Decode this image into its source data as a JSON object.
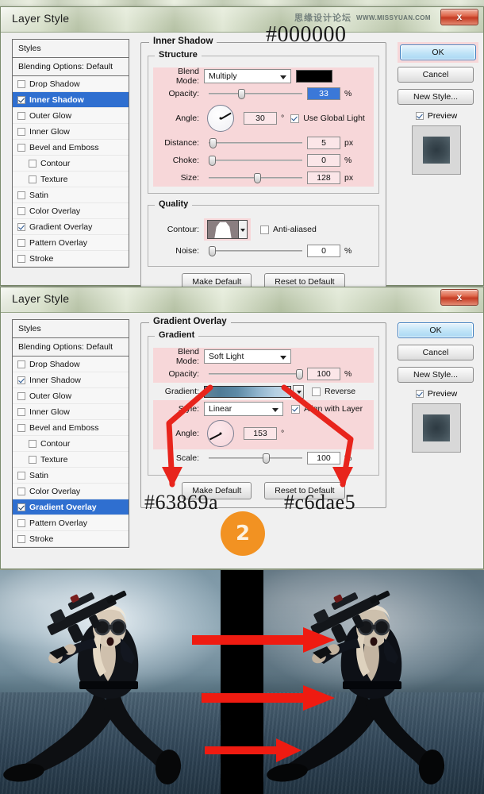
{
  "desktop": {
    "name": "blurred-green-wallpaper"
  },
  "watermark": {
    "cn": "思缘设计论坛",
    "url": "WWW.MISSYUAN.COM"
  },
  "dialog1": {
    "title": "Layer Style",
    "close_label": "x",
    "styles": {
      "header": "Styles",
      "blending": "Blending Options: Default",
      "items": [
        {
          "label": "Drop Shadow",
          "checked": false,
          "selected": false,
          "indent": false
        },
        {
          "label": "Inner Shadow",
          "checked": true,
          "selected": true,
          "indent": false
        },
        {
          "label": "Outer Glow",
          "checked": false,
          "selected": false,
          "indent": false
        },
        {
          "label": "Inner Glow",
          "checked": false,
          "selected": false,
          "indent": false
        },
        {
          "label": "Bevel and Emboss",
          "checked": false,
          "selected": false,
          "indent": false
        },
        {
          "label": "Contour",
          "checked": false,
          "selected": false,
          "indent": true
        },
        {
          "label": "Texture",
          "checked": false,
          "selected": false,
          "indent": true
        },
        {
          "label": "Satin",
          "checked": false,
          "selected": false,
          "indent": false
        },
        {
          "label": "Color Overlay",
          "checked": false,
          "selected": false,
          "indent": false
        },
        {
          "label": "Gradient Overlay",
          "checked": true,
          "selected": false,
          "indent": false
        },
        {
          "label": "Pattern Overlay",
          "checked": false,
          "selected": false,
          "indent": false
        },
        {
          "label": "Stroke",
          "checked": false,
          "selected": false,
          "indent": false
        }
      ]
    },
    "panel": {
      "legend": "Inner Shadow",
      "structure_legend": "Structure",
      "blend_mode_label": "Blend Mode:",
      "blend_mode_value": "Multiply",
      "shadow_color": "#000000",
      "opacity_label": "Opacity:",
      "opacity_value": "33",
      "opacity_unit": "%",
      "angle_label": "Angle:",
      "angle_value": "30",
      "angle_unit": "°",
      "use_global_light": "Use Global Light",
      "distance_label": "Distance:",
      "distance_value": "5",
      "distance_unit": "px",
      "choke_label": "Choke:",
      "choke_value": "0",
      "choke_unit": "%",
      "size_label": "Size:",
      "size_value": "128",
      "size_unit": "px",
      "quality_legend": "Quality",
      "contour_label": "Contour:",
      "anti_aliased": "Anti-aliased",
      "noise_label": "Noise:",
      "noise_value": "0",
      "noise_unit": "%",
      "make_default": "Make Default",
      "reset_to_default": "Reset to Default"
    },
    "buttons": {
      "ok": "OK",
      "cancel": "Cancel",
      "new_style": "New Style...",
      "preview": "Preview"
    },
    "hex_caption": "#000000"
  },
  "dialog2": {
    "title": "Layer Style",
    "close_label": "x",
    "styles": {
      "header": "Styles",
      "blending": "Blending Options: Default",
      "items": [
        {
          "label": "Drop Shadow",
          "checked": false,
          "selected": false,
          "indent": false
        },
        {
          "label": "Inner Shadow",
          "checked": true,
          "selected": false,
          "indent": false
        },
        {
          "label": "Outer Glow",
          "checked": false,
          "selected": false,
          "indent": false
        },
        {
          "label": "Inner Glow",
          "checked": false,
          "selected": false,
          "indent": false
        },
        {
          "label": "Bevel and Emboss",
          "checked": false,
          "selected": false,
          "indent": false
        },
        {
          "label": "Contour",
          "checked": false,
          "selected": false,
          "indent": true
        },
        {
          "label": "Texture",
          "checked": false,
          "selected": false,
          "indent": true
        },
        {
          "label": "Satin",
          "checked": false,
          "selected": false,
          "indent": false
        },
        {
          "label": "Color Overlay",
          "checked": false,
          "selected": false,
          "indent": false
        },
        {
          "label": "Gradient Overlay",
          "checked": true,
          "selected": true,
          "indent": false
        },
        {
          "label": "Pattern Overlay",
          "checked": false,
          "selected": false,
          "indent": false
        },
        {
          "label": "Stroke",
          "checked": false,
          "selected": false,
          "indent": false
        }
      ]
    },
    "panel": {
      "legend": "Gradient Overlay",
      "gradient_legend": "Gradient",
      "blend_mode_label": "Blend Mode:",
      "blend_mode_value": "Soft Light",
      "opacity_label": "Opacity:",
      "opacity_value": "100",
      "opacity_unit": "%",
      "gradient_label": "Gradient:",
      "reverse_label": "Reverse",
      "style_label": "Style:",
      "style_value": "Linear",
      "align_with_layer": "Align with Layer",
      "angle_label": "Angle:",
      "angle_value": "153",
      "angle_unit": "°",
      "scale_label": "Scale:",
      "scale_value": "100",
      "scale_unit": "%",
      "make_default": "Make Default",
      "reset_to_default": "Reset to Default"
    },
    "buttons": {
      "ok": "OK",
      "cancel": "Cancel",
      "new_style": "New Style...",
      "preview": "Preview"
    },
    "gradient_stop_left": "#63869a",
    "gradient_stop_right": "#c6dae5",
    "step_badge": "2"
  },
  "comparison": {
    "name": "before-after-photo",
    "left_caption": "",
    "right_caption": "",
    "arrow_count": 3
  },
  "colors": {
    "highlight_pink": "#f7d7d9",
    "selection_blue": "#2f6fd0",
    "arrow_red": "#e8241c",
    "badge_orange": "#f29222"
  }
}
